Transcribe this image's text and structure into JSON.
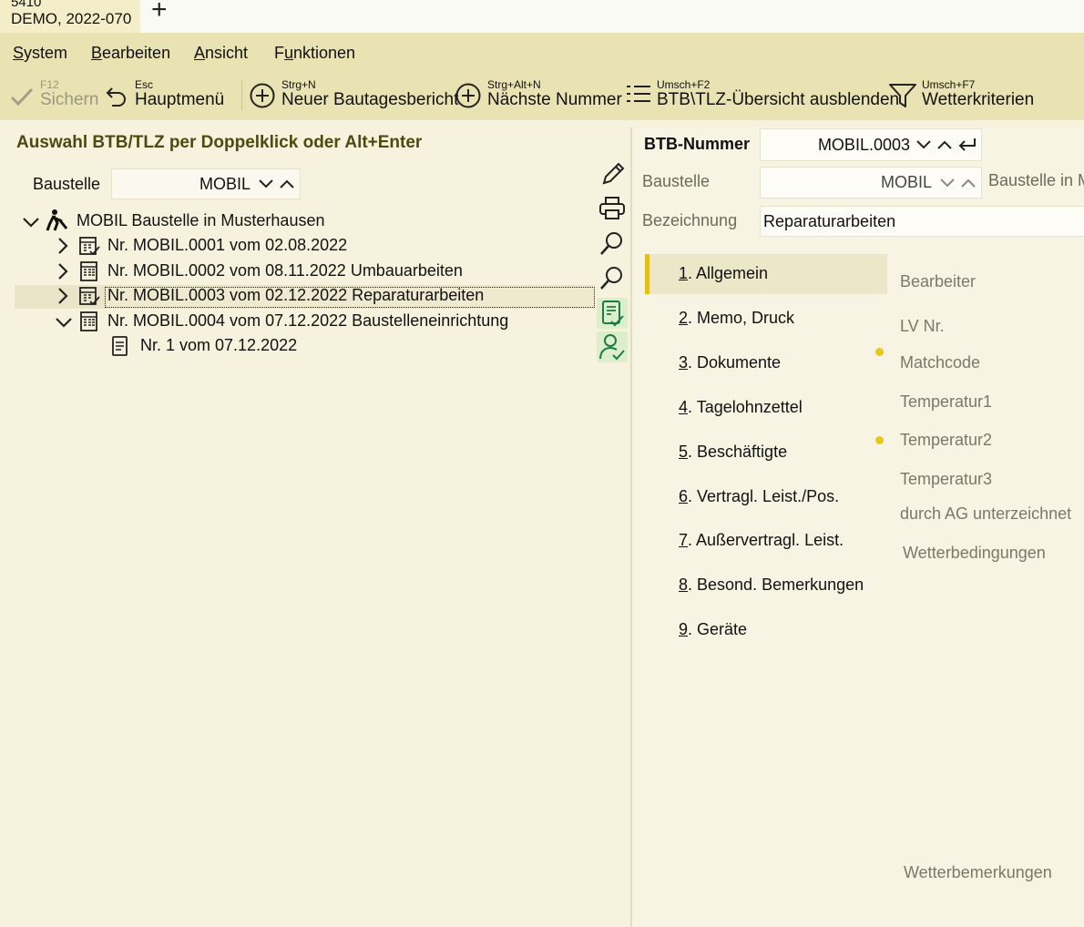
{
  "tab": {
    "line1": "5410",
    "line2": "DEMO, 2022-070",
    "add_label": "+"
  },
  "menu": [
    {
      "prefix": "",
      "ul": "S",
      "rest": "ystem"
    },
    {
      "prefix": "",
      "ul": "B",
      "rest": "earbeiten"
    },
    {
      "prefix": "",
      "ul": "A",
      "rest": "nsicht"
    },
    {
      "prefix": "F",
      "ul": "u",
      "rest": "nktionen"
    }
  ],
  "toolbar": {
    "save": {
      "shortcut": "F12",
      "label": "Sichern"
    },
    "main_menu": {
      "shortcut": "Esc",
      "label": "Hauptmenü"
    },
    "new_report": {
      "shortcut": "Strg+N",
      "label": "Neuer Bautagesbericht"
    },
    "next_number": {
      "shortcut": "Strg+Alt+N",
      "label": "Nächste Nummer"
    },
    "toggle_overview": {
      "shortcut": "Umsch+F2",
      "label": "BTB\\TLZ-Übersicht ausblenden"
    },
    "weather": {
      "shortcut": "Umsch+F7",
      "label": "Wetterkriterien"
    }
  },
  "left": {
    "title": "Auswahl BTB/TLZ per Doppelklick oder Alt+Enter",
    "baustelle_label": "Baustelle",
    "baustelle_value": "MOBIL",
    "tree": {
      "root": "MOBIL Baustelle in Musterhausen",
      "items": [
        "Nr. MOBIL.0001 vom 02.08.2022",
        "Nr. MOBIL.0002 vom 08.11.2022 Umbauarbeiten",
        "Nr. MOBIL.0003 vom 02.12.2022 Reparaturarbeiten",
        "Nr. MOBIL.0004 vom 07.12.2022 Baustelleneinrichtung"
      ],
      "child": "Nr. 1 vom 07.12.2022"
    }
  },
  "right": {
    "btb_label": "BTB-Nummer",
    "btb_value": "MOBIL.0003",
    "baustelle_label": "Baustelle",
    "baustelle_value": "MOBIL",
    "baustelle_desc": "Baustelle in M",
    "bezeichnung_label": "Bezeichnung",
    "bezeichnung_value": "Reparaturarbeiten",
    "nav": [
      {
        "ul": "1",
        "rest": ". Allgemein"
      },
      {
        "ul": "2",
        "rest": ". Memo, Druck"
      },
      {
        "ul": "3",
        "rest": ". Dokumente"
      },
      {
        "ul": "4",
        "rest": ". Tagelohnzettel"
      },
      {
        "ul": "5",
        "rest": ". Beschäftigte"
      },
      {
        "ul": "6",
        "rest": ". Vertragl. Leist./Pos."
      },
      {
        "ul": "7",
        "rest": ". Außervertragl. Leist."
      },
      {
        "ul": "8",
        "rest": ". Besond. Bemerkungen"
      },
      {
        "ul": "9",
        "rest": ". Geräte"
      }
    ],
    "fields": [
      "Bearbeiter",
      "LV Nr.",
      "Matchcode",
      "Temperatur1",
      "Temperatur2",
      "Temperatur3",
      "durch AG unterzeichnet",
      "Wetterbedingungen",
      "Wetterbemerkungen"
    ]
  },
  "colors": {
    "accent": "#e2bf1c",
    "band": "#e9e2b2",
    "panel": "#f6f2dd"
  }
}
